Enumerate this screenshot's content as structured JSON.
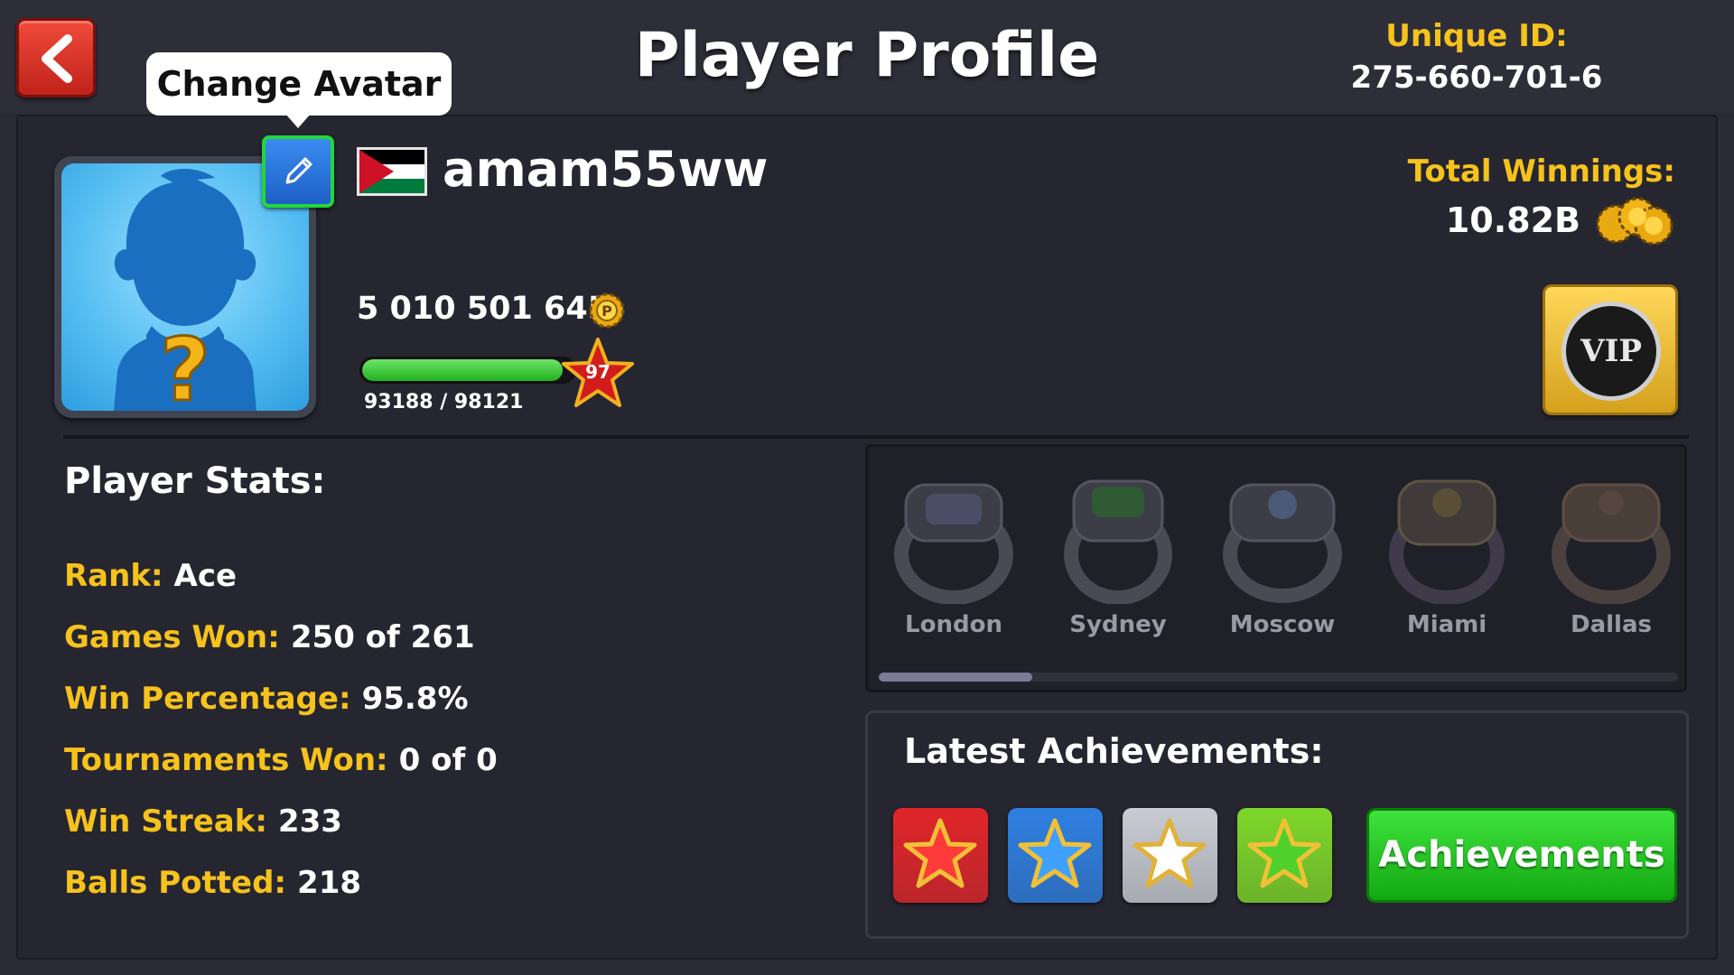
{
  "header": {
    "title": "Player Profile",
    "unique_id_label": "Unique ID:",
    "unique_id_value": "275-660-701-6"
  },
  "profile": {
    "tooltip": "Change Avatar",
    "username": "amam55ww",
    "country_flag": "jordan-flag",
    "coins": "5 010 501 645",
    "level": "97",
    "xp_text": "93188 / 98121",
    "xp_fraction": 0.9497,
    "total_winnings_label": "Total Winnings:",
    "total_winnings_value": "10.82B",
    "vip_text": "VIP"
  },
  "stats": {
    "title": "Player Stats:",
    "rows": [
      {
        "label": "Rank:",
        "value": "Ace"
      },
      {
        "label": "Games Won:",
        "value": "250 of 261"
      },
      {
        "label": "Win Percentage:",
        "value": "95.8%"
      },
      {
        "label": "Tournaments Won:",
        "value": "0 of 0"
      },
      {
        "label": "Win Streak:",
        "value": "233"
      },
      {
        "label": "Balls Potted:",
        "value": "218"
      }
    ]
  },
  "rings": {
    "items": [
      {
        "label": "London"
      },
      {
        "label": "Sydney"
      },
      {
        "label": "Moscow"
      },
      {
        "label": "Miami"
      },
      {
        "label": "Dallas"
      }
    ]
  },
  "achievements": {
    "title": "Latest Achievements:",
    "button_label": "Achievements",
    "tiles": [
      {
        "icon": "red-star-icon",
        "bg": "#e0262a",
        "star": "#ff3a3a"
      },
      {
        "icon": "blue-star-icon",
        "bg": "#2f7fe0",
        "star": "#3fa0ff"
      },
      {
        "icon": "silver-star-icon",
        "bg": "#c8ccd2",
        "star": "#ffffff"
      },
      {
        "icon": "green-star-icon",
        "bg": "#7ed62a",
        "star": "#4fd02a"
      }
    ]
  },
  "colors": {
    "accent_gold": "#f6c21c",
    "background": "#2b2b35",
    "button_green": "#12a812",
    "back_red": "#e0392c"
  }
}
